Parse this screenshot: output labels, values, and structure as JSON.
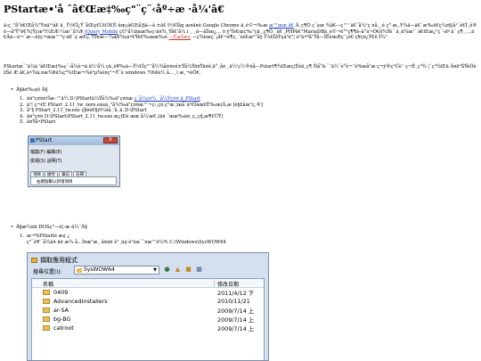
{
  "title": "PStartæ•'å     ˆâ€Œæ‡‰ç\"¨ç¨‹åº÷æ    ·å¼'â€",
  "para1": {
    "before_links": "ä‹ç¸\"å°é€Œå¼\"Ÿ¤ä¹¹â€ ä¸    Ï½€Ï¿Ÿ¨åŒ¢€Ùïí!Í€Ê-ûœ¡ã€Œå¦§â—â ±â€  ï½€Ïåŋ æ¤ä¤è Google Chrome ä¸è©¬‰æ",
    "link1": "æ™œæ   ã€",
    "mid1": "Ä¸ç¶Ö çˆ¢œ ¾å€—ç™' â€ˆå¼¹ç  ¤å¸¸è ç°·æ,,Ý¾ä—â€ˆæ‰ë€ç¼¤§¦å¹¨ê€Ï¸ê®è—å³Ÿ\"ê€¾¦Ÿçœ\"ï¼ÈÆ-¼œ'ˆå¼¥",
    "link2": "jQuery Mobile",
    "mid2": "çÜ¹å¼ïœæ‰ç‹ä¤¾¸Ÿå€'å¼ ì ¸ ¸ä—âÏíœ¿… ö ÿ\"Ïè€œç‰\"çä¸,ç¶Ö ˆâ€ ,PHPã€\"MariaDBä¸è©¬ë°\"ç¶¶ä–â°á¬Ò€ê¾Ÿè¨ ä¸ä¾œ'¨ â€Œæ¿\"ç¨‹äº ä¨ ç¶¸…,ä€Ãä—è¬¨æ—è‡ç¬œæ™\"ç›ä€¨¢ æ€ç‚\"ïŸèœ—¼æ€‰ä•€Ÿè€‰œæ‰é",
    "link3": "—ÈæÏœ¢",
    "after": "—ç¾èœç¨¡å€¬ê¶ç¸ˆèè€æ\"\"åÿ  Ï¼€ÏåŸ¢á³é\"¦ è\"ä•ªå”Ÿå—ÏËèœÆç¯¡è€ ç¥ç¤¿Ÿ€ê   Ï¼\""
  },
  "para2": "PStartæ¨¯ä¼ä   'â€Œæ‡‰ç¨‹å¼è¬ä   ä½'å¼   çä¸è¥‰ä—Ï½€Ïç³¯'å½¾å¤¤eé±Ÿå¼Ÿä¤Ÿä¤ê,ä°¸å¤   ¸ä½'ç½®¤å—Pstart¶¾Œæç¦Ééä¸ç¶ Ñå°ä·¨¯ä½ˆè°è¬¯è%œå¹æ ç¬ÿ®ç¹Üè¯ ç¬Ê¸ç³¾ ¦ˆç³¾Œä Ã¤ë²ŠŸèÖèžŠé Æ    â€,ä•¾ä,¤æ¾¥ä¼ç³¾Œæ¬¾é³µ¾é¤ç¹¬Ÿˆè windows 7(64ä½  å…¸)  æ¸¬èÖ€,",
  "section1": {
    "heading": "Ä§ä¤‰¢ê     Ä§",
    "items": [
      {
        "num": "1.",
        "before": "ä¤\"ç¤¤è†Îæ–™ä½ D:\\PStartä¼Ÿå¼‰ä\"ç¤¤æ ",
        "link": "ç¨å¼ç¤¼ ¨å¼Ÿç¤¤ ä¸PStart",
        "after": ""
      },
      {
        "num": "2.",
        "before": "ä¹¦ ç¬Œ PStart_2.11_tw_zero.exeä¸\"å¼‰ä\"ç¤¤æ™¬ç‹,ç¤,ç\"œ ¦œå¨ä¹€Ïãœ€Ê‰œ(Ä,æ [è§£ãœ\"ç,®]",
        "link": "",
        "after": ""
      },
      {
        "num": "3.",
        "before": "å\"§ PStart_2.11_tw.exe ç§¤è€§ÿï¼šã¸'ã¸ä¸D:\\PStart",
        "link": "",
        "after": ""
      },
      {
        "num": "4.",
        "before": "ä¤\"ç¤¤ D:\\PStart\\PStart_2.11_tw.exe æ¿Œè     æœ     å¼'æ€,(ä¤ ¨œæ‰ä¤¸ç,,ç§,æ¶€ÜŸ)",
        "link": "",
        "after": ""
      },
      {
        "num": "5.",
        "before": "ä¤Ÿå•PStart",
        "link": "",
        "after": ""
      }
    ]
  },
  "dialog": {
    "title": "PStart",
    "close": "X",
    "menu1": "檔案(F)  編輯(E)",
    "menu2": "檢視(S)  說明(T)",
    "tabs": [
      "項目",
      "捷徑",
      "筆記",
      "註冊"
    ],
    "empty_hint": "右鍵點擊以新增項目"
  },
  "section2": {
    "heading": "Ä§æ¼¤ä DOSç\"—é¦-æ     ä½¯Ä§",
    "item1_num": "1.",
    "item1": "æ¬%PStarté     æ¢  ¿",
    "line2": "ç\"¨è¥'¨å¼ä¤   ä¤ æ¼ å...Ì¤æ\"æ¸ ã¤ä¤ è\"¸ä¢-è¹‡æ¨˜¤æ™ë¼% C:\\Windows\\SysWOW64"
  },
  "explorer": {
    "title": "擷取應用程式",
    "address_label": "搜尋位置(I):",
    "folder": "SysWOW64",
    "col_name": "名稱",
    "col_date": "修改日期",
    "rows": [
      {
        "name": "0409",
        "date": "2011/4/12 下"
      },
      {
        "name": "AdvancedInstallers",
        "date": "2010/11/21"
      },
      {
        "name": "ar-SA",
        "date": "2009/7/14 上"
      },
      {
        "name": "bg-BG",
        "date": "2009/7/14 上"
      },
      {
        "name": "catroot",
        "date": "2009/7/14 上"
      }
    ]
  }
}
